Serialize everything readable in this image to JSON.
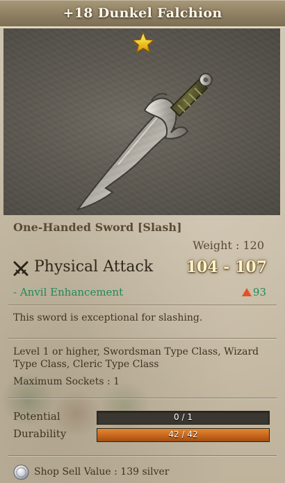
{
  "item": {
    "title": "+18 Dunkel Falchion",
    "image_icon": "falchion-sword-image",
    "star_icon": "gold-star-icon",
    "type_line": "One-Handed Sword [Slash]",
    "weight": "Weight : 120",
    "attack_label": "Physical Attack",
    "attack_value": "104 - 107",
    "enhancement_label": "- Anvil Enhancement",
    "enhancement_value": "93",
    "description": "This sword is exceptional for slashing.",
    "requirements": "Level 1 or higher, Swordsman Type Class, Wizard Type Class, Cleric Type Class",
    "sockets": "Maximum Sockets : 1",
    "potential": {
      "label": "Potential",
      "value": "0 / 1",
      "fraction": 0
    },
    "durability": {
      "label": "Durability",
      "value": "42 / 42",
      "fraction": 1
    },
    "sell": "Shop Sell Value : 139 silver"
  },
  "colors": {
    "title_bar": "#8f8063",
    "accent_green": "#1f8a57",
    "attack_value": "#fff3c9",
    "durability_fill": "#c8651c",
    "enhancement_triangle": "#e2512a"
  }
}
